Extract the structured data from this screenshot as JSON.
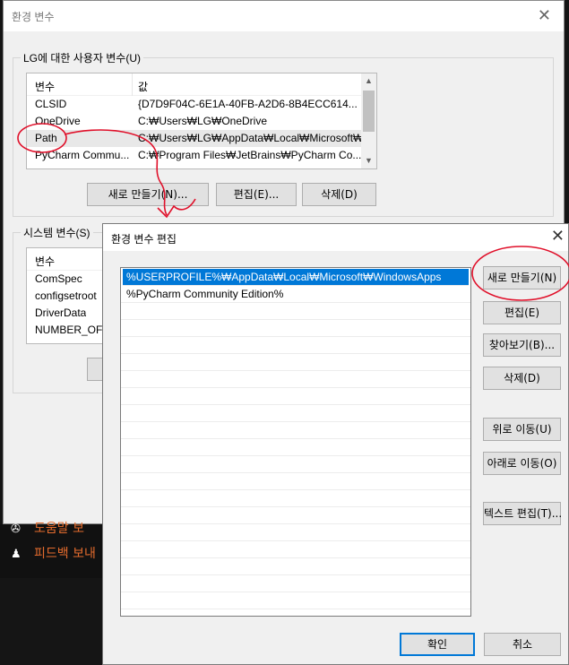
{
  "back_dialog": {
    "title": "환경 변수",
    "user_vars": {
      "group_label": "LG에 대한 사용자 변수(U)",
      "columns": [
        "변수",
        "값"
      ],
      "rows": [
        {
          "name": "CLSID",
          "value": "{D7D9F04C-6E1A-40FB-A2D6-8B4ECC614..."
        },
        {
          "name": "OneDrive",
          "value": "C:₩Users₩LG₩OneDrive"
        },
        {
          "name": "Path",
          "value": "C:₩Users₩LG₩AppData₩Local₩Microsoft₩..."
        },
        {
          "name": "PyCharm Commu...",
          "value": "C:₩Program Files₩JetBrains₩PyCharm Co..."
        }
      ],
      "buttons": {
        "new": "새로 만들기(N)...",
        "edit": "편집(E)...",
        "delete": "삭제(D)"
      }
    },
    "sys_vars": {
      "group_label": "시스템 변수(S)",
      "columns": [
        "변수"
      ],
      "rows": [
        {
          "name": "ComSpec"
        },
        {
          "name": "configsetroot"
        },
        {
          "name": "DriverData"
        },
        {
          "name": "NUMBER_OF_P"
        }
      ]
    }
  },
  "feedback": {
    "item1": "도움말 보",
    "item2": "피드백 보내"
  },
  "edit_dialog": {
    "title": "환경 변수 편집",
    "paths": [
      "%USERPROFILE%₩AppData₩Local₩Microsoft₩WindowsApps",
      "%PyCharm Community Edition%"
    ],
    "buttons": {
      "new": "새로 만들기(N)",
      "edit": "편집(E)",
      "browse": "찾아보기(B)...",
      "delete": "삭제(D)",
      "move_up": "위로 이동(U)",
      "move_down": "아래로 이동(O)",
      "edit_text": "텍스트 편집(T)...",
      "ok": "확인",
      "cancel": "취소"
    }
  },
  "colors": {
    "selection": "#0078d7",
    "annotation": "#e0102a",
    "accent_orange": "#e36b2d"
  }
}
